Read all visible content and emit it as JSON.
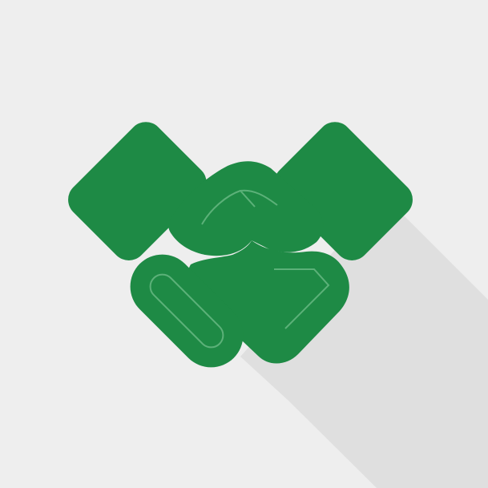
{
  "icon": {
    "name": "handshake-icon",
    "colors": {
      "background": "#eeeeee",
      "shadow": "#d9d9d9",
      "primary": "#1e8a45",
      "detail": "#8fd1a4"
    }
  }
}
